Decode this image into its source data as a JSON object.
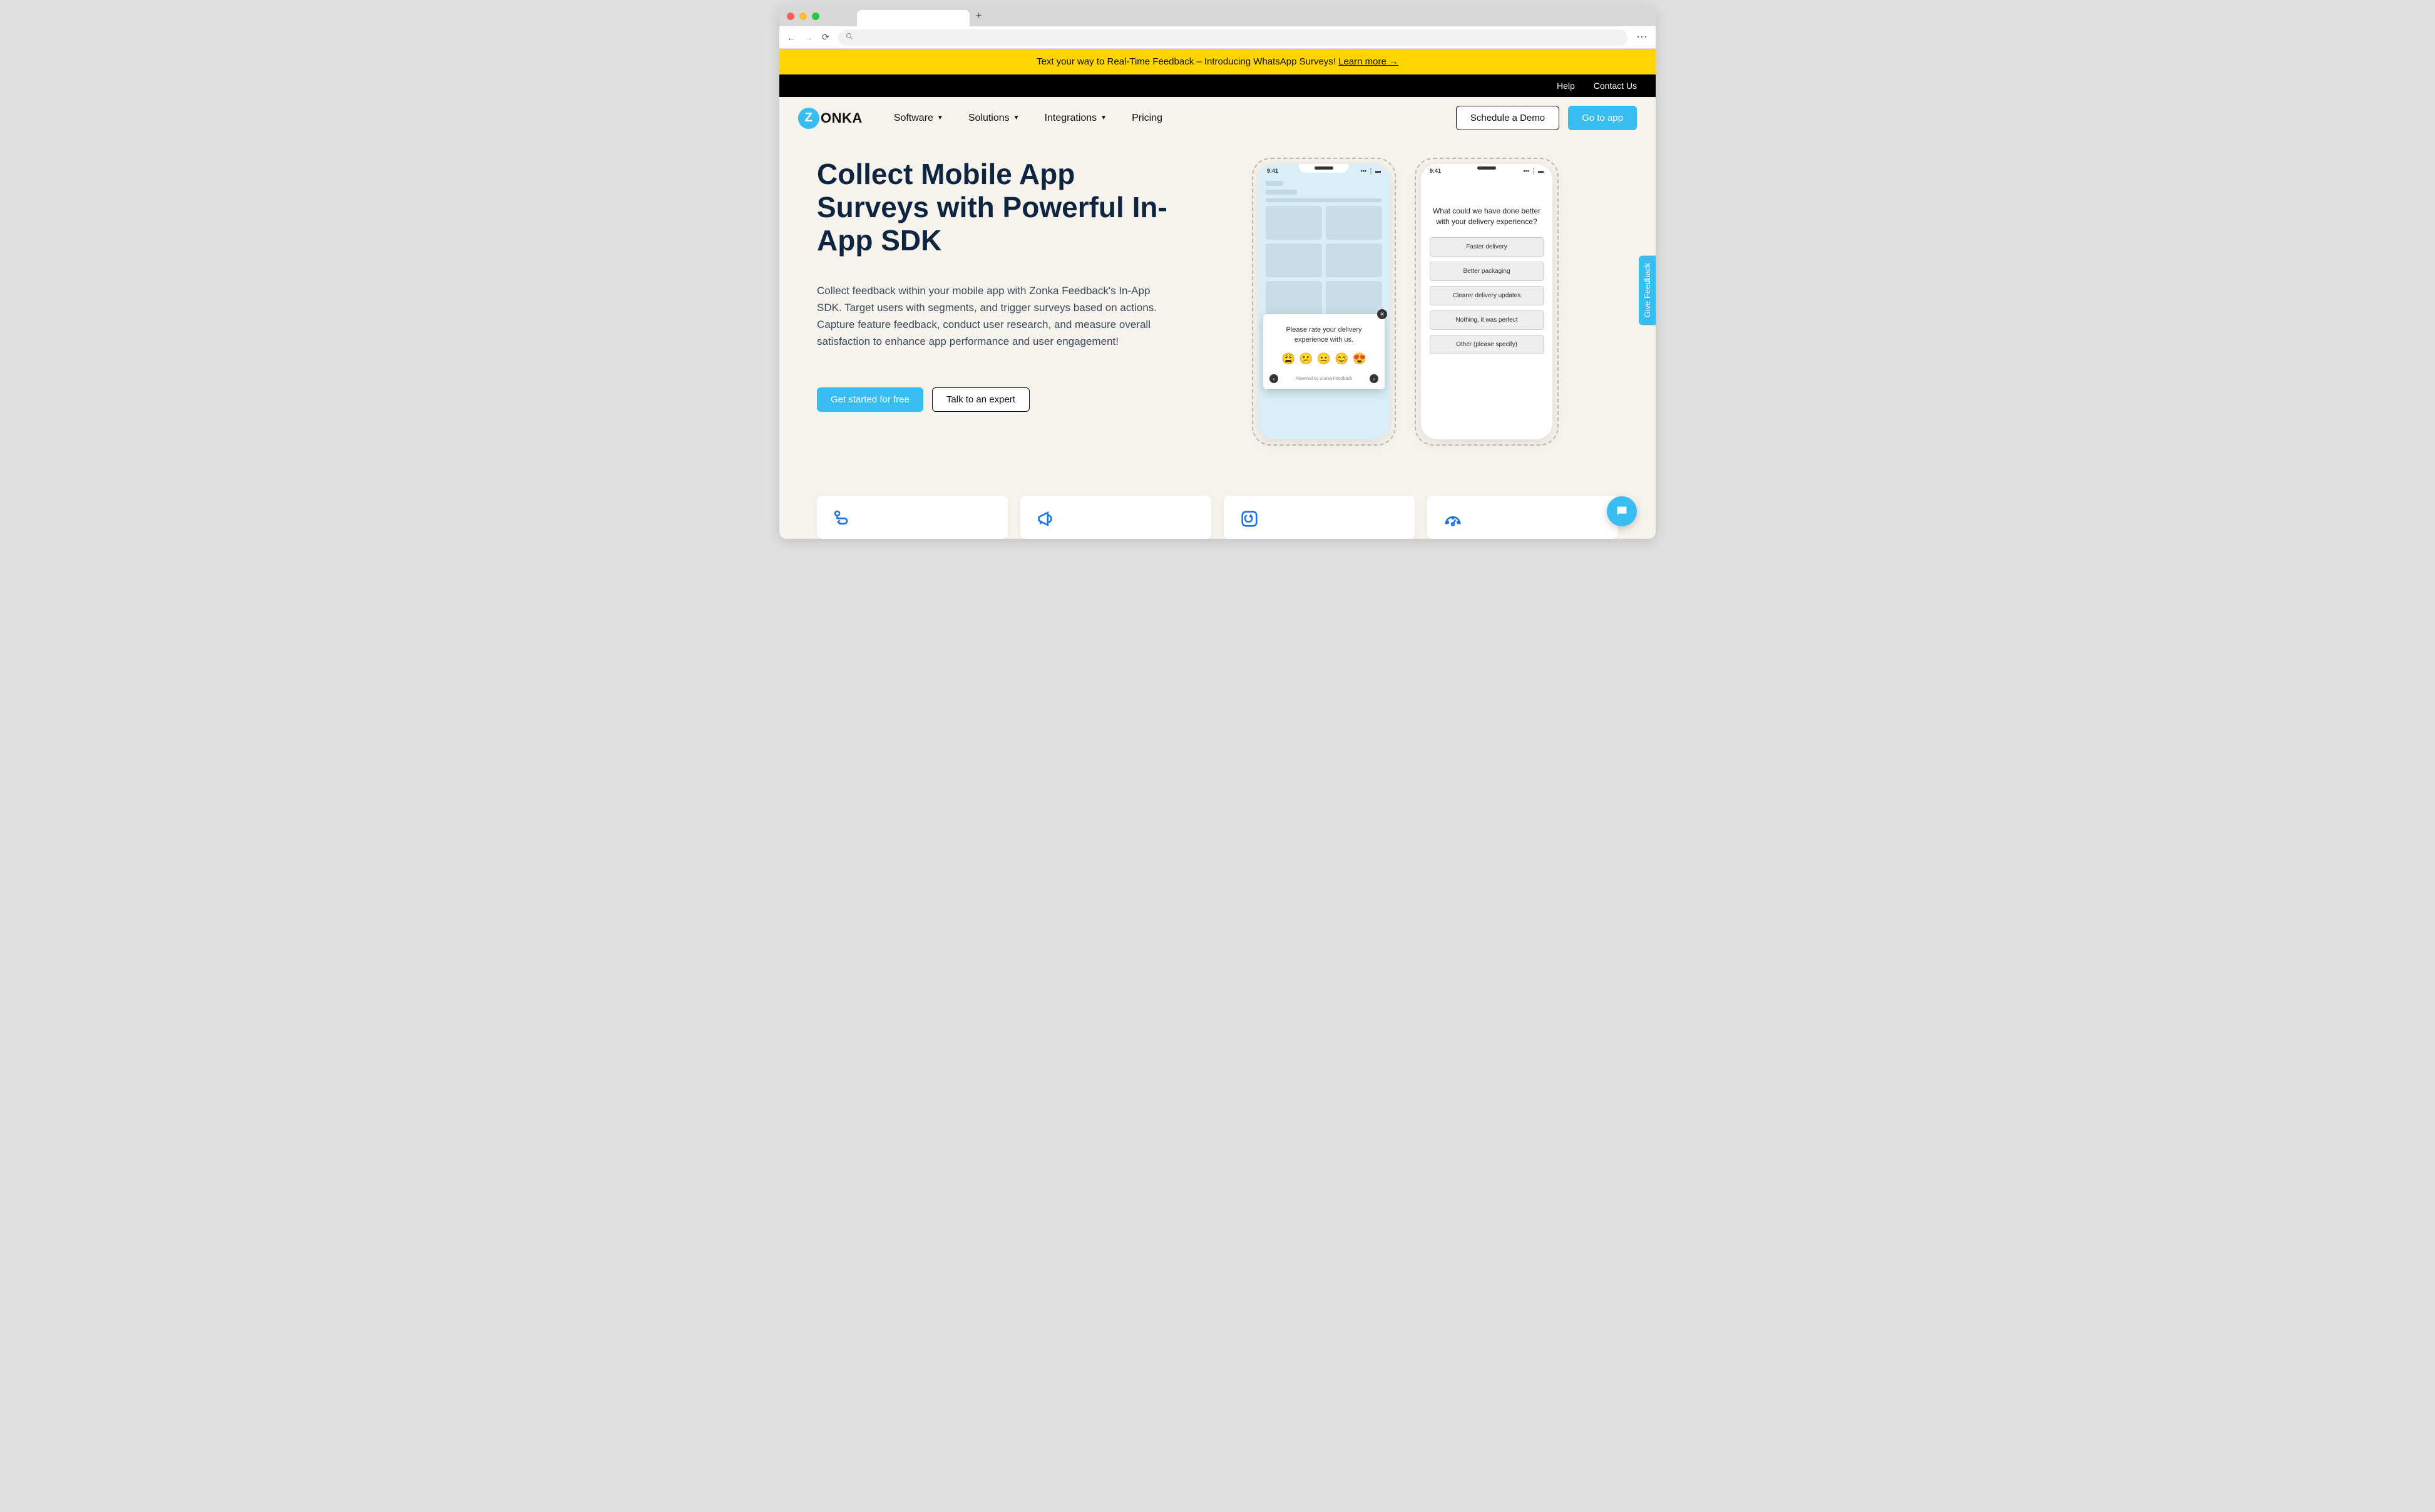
{
  "announce": {
    "text": "Text your way to Real-Time Feedback – Introducing WhatsApp Surveys! ",
    "link": "Learn more →"
  },
  "topbar": {
    "help": "Help",
    "contact": "Contact Us"
  },
  "logo": {
    "badge": "Z",
    "text": "ONKA"
  },
  "nav": {
    "software": "Software",
    "solutions": "Solutions",
    "integrations": "Integrations",
    "pricing": "Pricing"
  },
  "nav_actions": {
    "demo": "Schedule a Demo",
    "goto": "Go to app"
  },
  "hero": {
    "title": "Collect Mobile App Surveys with Powerful In-App SDK",
    "desc": "Collect feedback within your mobile app with Zonka Feedback's In-App SDK. Target users with segments, and trigger surveys based on actions. Capture feature feedback, conduct user research, and measure overall satisfaction to enhance app performance and user engagement!",
    "cta_start": "Get started for free",
    "cta_expert": "Talk to an expert"
  },
  "phone1": {
    "time": "9:41",
    "popup_text": "Please rate your delivery experience with us.",
    "powered": "Powered by Zonka Feedback",
    "emojis": [
      "😩",
      "😕",
      "😐",
      "😊",
      "😍"
    ]
  },
  "phone2": {
    "time": "9:41",
    "question": "What could we have done better with your delivery experience?",
    "options": [
      "Faster delivery",
      "Better packaging",
      "Clearer delivery updates",
      "Nothing, it was perfect",
      "Other (please specify)"
    ]
  },
  "feedback_tab": "Give Feedback"
}
